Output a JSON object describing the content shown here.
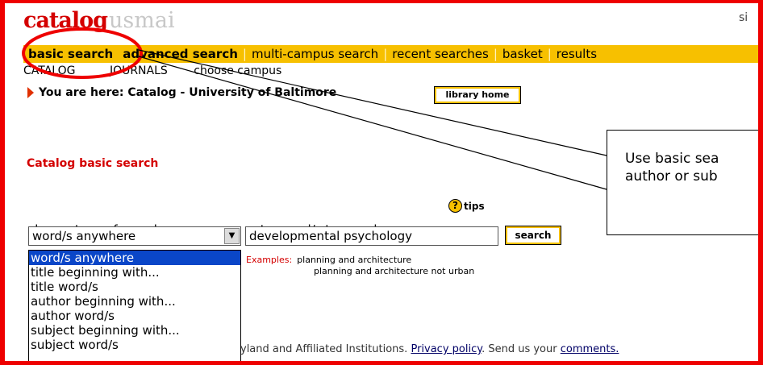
{
  "header": {
    "logo_catalog": "catalog",
    "logo_usmai": "usmai",
    "cut_text": "si"
  },
  "nav": {
    "tabs": [
      "basic search",
      "advanced search",
      "multi-campus search",
      "recent searches",
      "basket",
      "results"
    ],
    "separator": "|"
  },
  "subnav": {
    "items": [
      "CATALOG",
      "JOURNALS",
      "choose campus"
    ]
  },
  "location": {
    "text": "You are here: Catalog - University of Baltimore",
    "library_home": "library home"
  },
  "search": {
    "section_title": "Catalog basic search",
    "type_label": "choose type of search",
    "words_label": "enter word/s to search",
    "tips_label": "tips",
    "tips_icon": "question-icon",
    "selected_type": "word/s anywhere",
    "options": [
      "word/s anywhere",
      "title beginning with...",
      "title word/s",
      "author beginning with...",
      "author word/s",
      "subject beginning with...",
      "subject word/s"
    ],
    "query_value": "developmental psychology",
    "search_button": "search",
    "examples_label": "Examples:",
    "example_1": "planning and architecture",
    "example_2": "planning and architecture not urban"
  },
  "footer": {
    "text_before": "yland and Affiliated Institutions. ",
    "privacy_link": "Privacy policy",
    "text_middle": ". Send us your ",
    "comments_link": "comments."
  },
  "callout": {
    "line1": "Use basic sea",
    "line2": "author or sub"
  },
  "colors": {
    "frame": "#ee0000",
    "nav_bar": "#f7c000",
    "brand_red": "#d40000",
    "selected_option": "#0a46c8"
  }
}
